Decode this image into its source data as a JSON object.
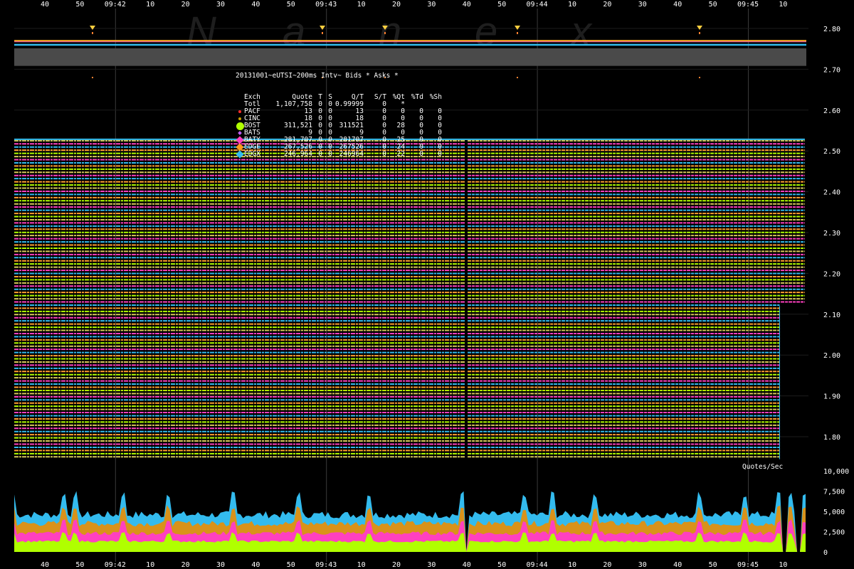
{
  "chart_data": [
    {
      "type": "line",
      "title": "20131001~eUTSI~200ms Intv~ Bids * Asks *",
      "x_tick_labels_top": [
        "40",
        "50",
        "09:42",
        "10",
        "20",
        "30",
        "40",
        "50",
        "09:43",
        "10",
        "20",
        "30",
        "40",
        "50",
        "09:44",
        "10",
        "20",
        "30",
        "40",
        "50",
        "09:45",
        "10"
      ],
      "x_tick_labels_bottom": [
        "40",
        "50",
        "09:42",
        "10",
        "20",
        "30",
        "40",
        "50",
        "09:43",
        "10",
        "20",
        "30",
        "40",
        "50",
        "09:44",
        "10",
        "20",
        "30",
        "40",
        "50",
        "09:45",
        "10"
      ],
      "x_range": [
        "09:41:33",
        "09:45:13"
      ],
      "y_ticks": [
        "2.80",
        "2.70",
        "2.60",
        "2.50",
        "2.40",
        "2.30",
        "2.20",
        "2.10",
        "2.00",
        "1.90",
        "1.80"
      ],
      "ylim": [
        1.74,
        2.83
      ],
      "ladder": {
        "levels_to_2_12": 73,
        "top_price": 2.525,
        "bottom_price": 1.745,
        "lower_block_ends": "09:45:05",
        "upper_block_ends": "09:45:12"
      },
      "nbbo": {
        "bid": 2.76,
        "ask": 2.77
      },
      "watermark": "N a n e x",
      "stats_table": {
        "header": [
          "Exch",
          "Quote",
          "T",
          "S",
          "Q/T",
          "S/T",
          "%Qt",
          "%Td",
          "%Sh"
        ],
        "rows": [
          {
            "marker": "",
            "color": "#ffffff",
            "cells": [
              "Totl",
              "1,107,758",
              "0",
              "0",
              "0.99999",
              "0",
              "*",
              "",
              ""
            ]
          },
          {
            "marker": "dot",
            "color": "#ff2a2a",
            "cells": [
              "PACF",
              "13",
              "0",
              "0",
              "13",
              "0",
              "0",
              "0",
              "0"
            ]
          },
          {
            "marker": "dot",
            "color": "#c8a000",
            "cells": [
              "CINC",
              "18",
              "0",
              "0",
              "18",
              "0",
              "0",
              "0",
              "0"
            ]
          },
          {
            "marker": "big-dot",
            "color": "#b0ff00",
            "cells": [
              "BOST",
              "311,521",
              "0",
              "0",
              "311521",
              "0",
              "28",
              "0",
              "0"
            ]
          },
          {
            "marker": "diamond",
            "color": "#c060ff",
            "cells": [
              "BATS",
              "9",
              "0",
              "0",
              "9",
              "0",
              "0",
              "0",
              "0"
            ]
          },
          {
            "marker": "big-diamond",
            "color": "#ff40c0",
            "cells": [
              "BATY",
              "281,707",
              "0",
              "0",
              "281707",
              "0",
              "25",
              "0",
              "0"
            ]
          },
          {
            "marker": "big-diamond",
            "color": "#ff9a1a",
            "cells": [
              "EDGE",
              "267,526",
              "0",
              "0",
              "267526",
              "0",
              "24",
              "0",
              "0"
            ]
          },
          {
            "marker": "big-diamond",
            "color": "#33bbee",
            "cells": [
              "EDGX",
              "246,964",
              "0",
              "0",
              "246964",
              "0",
              "22",
              "0",
              "0"
            ]
          }
        ]
      }
    },
    {
      "type": "area",
      "ylabel": "Quotes/Sec",
      "y_ticks": [
        "10,000",
        "7,500",
        "5,000",
        "2,500",
        "0"
      ],
      "ylim": [
        0,
        10000
      ],
      "series": [
        {
          "name": "BOST",
          "color": "#b0ff00",
          "typical": 1300
        },
        {
          "name": "BATY",
          "color": "#ff40c0",
          "typical": 2300
        },
        {
          "name": "EDGE",
          "color": "#d9921a",
          "typical": 3500
        },
        {
          "name": "EDGX",
          "color": "#33bbee",
          "typical": 4600
        }
      ],
      "spikes_x": [
        "09:41:33",
        "09:41:47",
        "09:41:50",
        "09:42:03",
        "09:42:16",
        "09:42:34",
        "09:42:52",
        "09:43:11",
        "09:43:37",
        "09:43:54",
        "09:44:02",
        "09:44:14",
        "09:44:43",
        "09:44:55",
        "09:45:05",
        "09:45:08",
        "09:45:12"
      ],
      "gaps_x": [
        "09:43:38",
        "09:45:06",
        "09:45:07",
        "09:45:10",
        "09:45:11"
      ]
    }
  ],
  "colors": {
    "background": "#000000",
    "gridline": "#3a3a3a",
    "nbbo_band": "#4a4a4a",
    "watermark": "#1e1e1e",
    "trade_marker": "#ffd040"
  }
}
